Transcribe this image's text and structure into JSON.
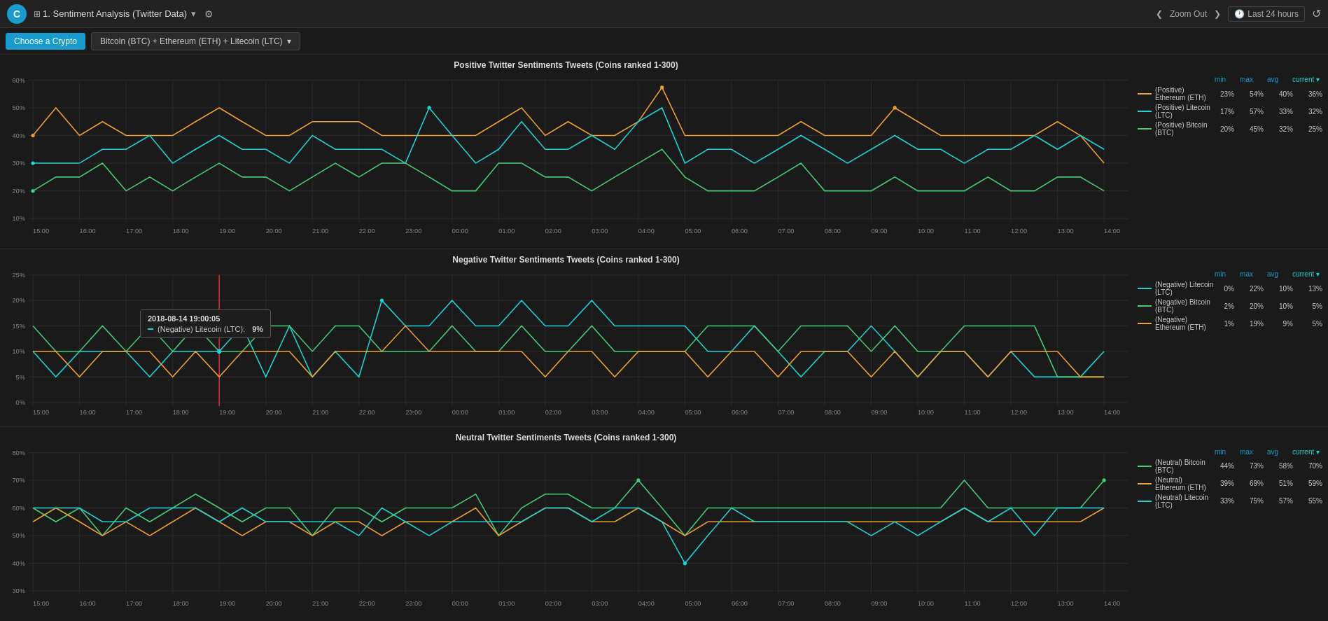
{
  "header": {
    "logo": "C",
    "dashboard_title": "1. Sentiment Analysis (Twitter Data)",
    "title_dropdown": "▾",
    "gear_icon": "⚙",
    "zoom_out": "Zoom Out",
    "zoom_chevron_left": "❮",
    "zoom_chevron_right": "❯",
    "time_label": "Last 24 hours",
    "refresh_icon": "↺"
  },
  "toolbar": {
    "choose_btn": "Choose a Crypto",
    "crypto_select": "Bitcoin (BTC) + Ethereum (ETH) + Litecoin (LTC)",
    "dropdown_arrow": "▾"
  },
  "charts": [
    {
      "id": "positive",
      "title": "Positive Twitter Sentiments Tweets (Coins ranked 1-300)",
      "y_labels": [
        "60%",
        "50%",
        "40%",
        "30%",
        "20%",
        "10%"
      ],
      "x_labels": [
        "15:00",
        "16:00",
        "17:00",
        "18:00",
        "19:00",
        "20:00",
        "21:00",
        "22:00",
        "23:00",
        "00:00",
        "01:00",
        "02:00",
        "03:00",
        "04:00",
        "05:00",
        "06:00",
        "07:00",
        "08:00",
        "09:00",
        "10:00",
        "11:00",
        "12:00",
        "13:00",
        "14:00"
      ],
      "legend": {
        "headers": [
          "min",
          "max",
          "avg",
          "current ▾"
        ],
        "items": [
          {
            "label": "(Positive) Ethereum (ETH)",
            "color": "#f0a030",
            "min": "23%",
            "max": "54%",
            "avg": "40%",
            "current": "36%"
          },
          {
            "label": "(Positive) Litecoin (LTC)",
            "color": "#1dd3d3",
            "min": "17%",
            "max": "57%",
            "avg": "33%",
            "current": "32%"
          },
          {
            "label": "(Positive) Bitcoin (BTC)",
            "color": "#44cc77",
            "min": "20%",
            "max": "45%",
            "avg": "32%",
            "current": "25%"
          }
        ]
      }
    },
    {
      "id": "negative",
      "title": "Negative Twitter Sentiments Tweets (Coins ranked 1-300)",
      "y_labels": [
        "25%",
        "20%",
        "15%",
        "10%",
        "5%",
        "0%"
      ],
      "x_labels": [
        "15:00",
        "16:00",
        "17:00",
        "18:00",
        "19:00",
        "20:00",
        "21:00",
        "22:00",
        "23:00",
        "00:00",
        "01:00",
        "02:00",
        "03:00",
        "04:00",
        "05:00",
        "06:00",
        "07:00",
        "08:00",
        "09:00",
        "10:00",
        "11:00",
        "12:00",
        "13:00",
        "14:00"
      ],
      "tooltip": {
        "date": "2018-08-14 19:00:05",
        "label": "(Negative) Litecoin (LTC):",
        "value": "9%"
      },
      "legend": {
        "headers": [
          "min",
          "max",
          "avg",
          "current ▾"
        ],
        "items": [
          {
            "label": "(Negative) Litecoin (LTC)",
            "color": "#1dd3d3",
            "min": "0%",
            "max": "22%",
            "avg": "10%",
            "current": "13%"
          },
          {
            "label": "(Negative) Bitcoin (BTC)",
            "color": "#44cc77",
            "min": "2%",
            "max": "20%",
            "avg": "10%",
            "current": "5%"
          },
          {
            "label": "(Negative) Ethereum (ETH)",
            "color": "#f0a030",
            "min": "1%",
            "max": "19%",
            "avg": "9%",
            "current": "5%"
          }
        ]
      }
    },
    {
      "id": "neutral",
      "title": "Neutral Twitter Sentiments Tweets (Coins ranked 1-300)",
      "y_labels": [
        "80%",
        "70%",
        "60%",
        "50%",
        "40%",
        "30%"
      ],
      "x_labels": [
        "15:00",
        "16:00",
        "17:00",
        "18:00",
        "19:00",
        "20:00",
        "21:00",
        "22:00",
        "23:00",
        "00:00",
        "01:00",
        "02:00",
        "03:00",
        "04:00",
        "05:00",
        "06:00",
        "07:00",
        "08:00",
        "09:00",
        "10:00",
        "11:00",
        "12:00",
        "13:00",
        "14:00"
      ],
      "legend": {
        "headers": [
          "min",
          "max",
          "avg",
          "current ▾"
        ],
        "items": [
          {
            "label": "(Neutral) Bitcoin (BTC)",
            "color": "#44cc77",
            "min": "44%",
            "max": "73%",
            "avg": "58%",
            "current": "70%"
          },
          {
            "label": "(Neutral) Ethereum (ETH)",
            "color": "#f0a030",
            "min": "39%",
            "max": "69%",
            "avg": "51%",
            "current": "59%"
          },
          {
            "label": "(Neutral) Litecoin (LTC)",
            "color": "#1dd3d3",
            "min": "33%",
            "max": "75%",
            "avg": "57%",
            "current": "55%"
          }
        ]
      }
    }
  ]
}
